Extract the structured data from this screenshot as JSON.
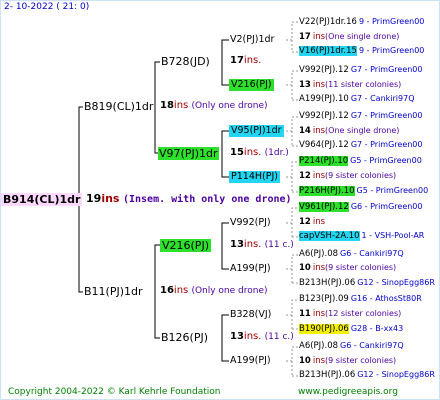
{
  "header": {
    "date": "2- 10-2022 ( 21: 0)"
  },
  "root": {
    "label": "B914(CL)1dr",
    "ins": "19",
    "insWord": "ins",
    "note": "(Insem. with only one drone)"
  },
  "gen1": {
    "upper": {
      "label": "B819(CL)1dr",
      "ins": "18",
      "insWord": "ins",
      "note": "(Only one drone)"
    },
    "lower": {
      "label": "B11(PJ)1dr",
      "ins": "16",
      "insWord": "ins",
      "note": "(Only one drone)"
    }
  },
  "gen2": [
    {
      "label": "B728(JD)",
      "ins": "17",
      "insWord": "ins.",
      "note": ""
    },
    {
      "label": "V97(PJ)1dr",
      "ins": "15",
      "insWord": "ins.",
      "note": "(1dr.)"
    },
    {
      "label": "V216(PJ)",
      "ins": "13",
      "insWord": "ins.",
      "note": "(11 c.)"
    },
    {
      "label": "B126(PJ)",
      "ins": "13",
      "insWord": "ins.",
      "note": "(11 c.)"
    }
  ],
  "gen3": [
    {
      "label": "V2(PJ)1dr",
      "ins": "17",
      "insWord": "ins.",
      "note": ""
    },
    {
      "label": "V216(PJ)",
      "ins": "",
      "insWord": "",
      "note": ""
    },
    {
      "label": "V95(PJ)1dr",
      "ins": "14",
      "insWord": "ins.",
      "note": ""
    },
    {
      "label": "P114H(PJ)",
      "ins": "",
      "insWord": "",
      "note": ""
    },
    {
      "label": "V992(PJ)",
      "ins": "12",
      "insWord": "ins.",
      "note": ""
    },
    {
      "label": "A199(PJ)",
      "ins": "",
      "insWord": "",
      "note": ""
    },
    {
      "label": "B328(VJ)",
      "ins": "11",
      "insWord": "ins.",
      "note": ""
    },
    {
      "label": "A199(PJ)",
      "ins": "",
      "insWord": "",
      "note": ""
    }
  ],
  "gen4": [
    {
      "label": "V22(PJ)1dr.16",
      "place": "9 - PrimGreen00"
    },
    {
      "ins": "17",
      "insWord": "ins",
      "note": "(One single drone)"
    },
    {
      "label": "V16(PJ)1dr.15",
      "place": "9 - PrimGreen00"
    },
    {
      "label": "V992(PJ).12",
      "place": "G7 - PrimGreen00"
    },
    {
      "ins": "13",
      "insWord": "ins",
      "note": "(11 sister colonies)"
    },
    {
      "label": "A199(PJ).10",
      "place": "G7 - Cankiri97Q"
    },
    {
      "label": "V992(PJ).12",
      "place": "G7 - PrimGreen00"
    },
    {
      "ins": "14",
      "insWord": "ins",
      "note": "(One single drone)"
    },
    {
      "label": "V964(PJ).12",
      "place": "G7 - PrimGreen00"
    },
    {
      "label": "P214(PJ).10",
      "place": "G5 - PrimGreen00"
    },
    {
      "ins": "12",
      "insWord": "ins",
      "note": "(9 sister colonies)"
    },
    {
      "label": "P216H(PJ).10",
      "place": "G5 - PrimGreen00"
    },
    {
      "label": "V961(PJ).12",
      "place": "G6 - PrimGreen00"
    },
    {
      "ins": "12",
      "insWord": "ins",
      "note": ""
    },
    {
      "label": "capVSH-2A.10",
      "place": "1 - VSH-Pool-AR"
    },
    {
      "label": "A6(PJ).08",
      "place": "G6 - Cankiri97Q"
    },
    {
      "ins": "10",
      "insWord": "ins",
      "note": "(9 sister colonies)"
    },
    {
      "label": "B213H(PJ).06",
      "place": "G12 - SinopEgg86R"
    },
    {
      "label": "B123(PJ).09",
      "place": "G16 - AthosSt80R"
    },
    {
      "ins": "11",
      "insWord": "ins",
      "note": "(12 sister colonies)"
    },
    {
      "label": "B190(PJ).06",
      "place": "G28 - B-xx43"
    },
    {
      "label": "A6(PJ).08",
      "place": "G6 - Cankiri97Q"
    },
    {
      "ins": "10",
      "insWord": "ins",
      "note": "(9 sister colonies)"
    },
    {
      "label": "B213H(PJ).06",
      "place": "G12 - SinopEgg86R"
    }
  ],
  "footer": {
    "copyright": "Copyright 2004-2022 © Karl Kehrle Foundation",
    "site": "www.pedigreeapis.org"
  }
}
